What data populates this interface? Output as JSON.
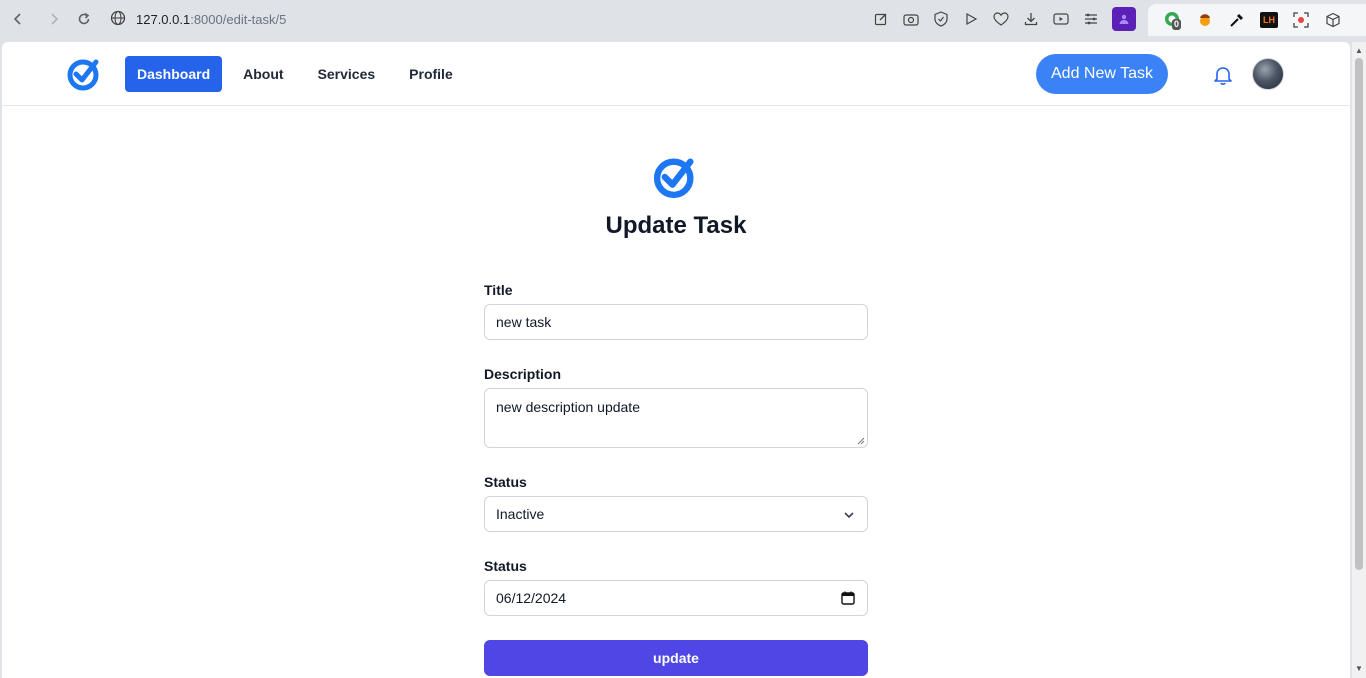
{
  "browser": {
    "url_host": "127.0.0.1",
    "url_path": ":8000/edit-task/5",
    "extension_badge": "0",
    "lh_label": "LH"
  },
  "header": {
    "nav": [
      "Dashboard",
      "About",
      "Services",
      "Profile"
    ],
    "add_button": "Add New Task"
  },
  "form": {
    "title": "Update Task",
    "title_label": "Title",
    "title_value": "new task",
    "description_label": "Description",
    "description_value": "new description update",
    "status_label": "Status",
    "status_value": "Inactive",
    "date_label": "Status",
    "date_value": "06/12/2024",
    "submit_label": "update"
  },
  "colors": {
    "primary": "#2563eb",
    "accent_button": "#3b82f6",
    "submit": "#4f46e5",
    "logo_blue": "#1d76f2"
  }
}
